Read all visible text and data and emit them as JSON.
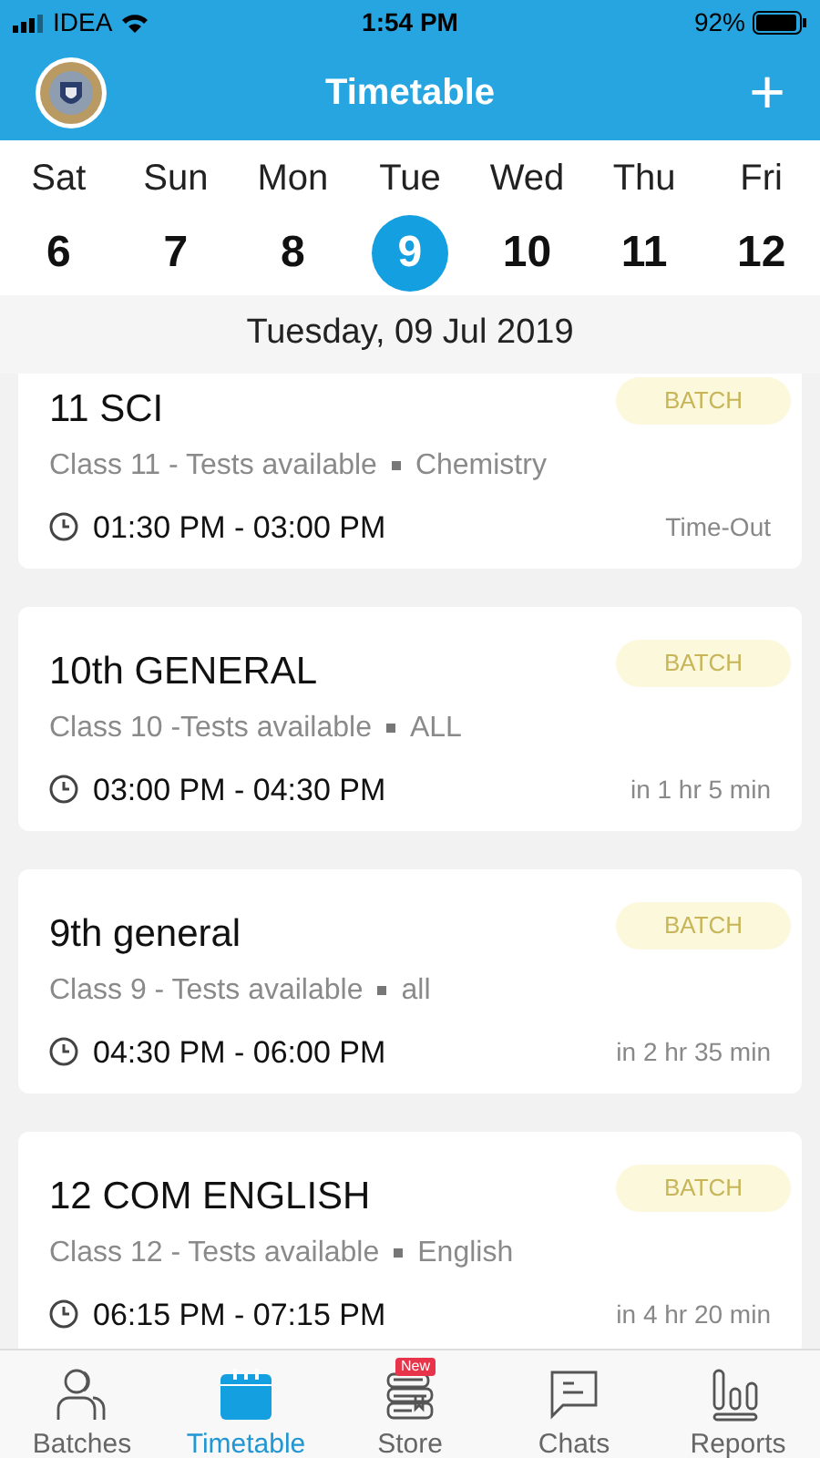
{
  "status_bar": {
    "carrier": "IDEA",
    "time": "1:54 PM",
    "battery": "92%"
  },
  "header": {
    "title": "Timetable",
    "action": "+"
  },
  "days": [
    {
      "weekday": "Sat",
      "date": "6",
      "selected": false
    },
    {
      "weekday": "Sun",
      "date": "7",
      "selected": false
    },
    {
      "weekday": "Mon",
      "date": "8",
      "selected": false
    },
    {
      "weekday": "Tue",
      "date": "9",
      "selected": true
    },
    {
      "weekday": "Wed",
      "date": "10",
      "selected": false
    },
    {
      "weekday": "Thu",
      "date": "11",
      "selected": false
    },
    {
      "weekday": "Fri",
      "date": "12",
      "selected": false
    }
  ],
  "date_heading": "Tuesday, 09 Jul 2019",
  "sessions": [
    {
      "title": "11 SCI",
      "badge": "BATCH",
      "class": "Class 11 - Tests available",
      "subject": "Chemistry",
      "time": "01:30 PM - 03:00 PM",
      "status": "Time-Out"
    },
    {
      "title": "10th GENERAL",
      "badge": "BATCH",
      "class": "Class 10 -Tests available",
      "subject": "ALL",
      "time": "03:00 PM - 04:30 PM",
      "status": "in 1 hr 5 min"
    },
    {
      "title": "9th general",
      "badge": "BATCH",
      "class": "Class 9 - Tests available",
      "subject": "all",
      "time": "04:30 PM - 06:00 PM",
      "status": "in 2 hr 35 min"
    },
    {
      "title": "12 COM ENGLISH",
      "badge": "BATCH",
      "class": "Class 12 - Tests available",
      "subject": "English",
      "time": "06:15 PM - 07:15 PM",
      "status": "in 4 hr 20 min"
    }
  ],
  "tabs": [
    {
      "kind": "batches",
      "label": "Batches",
      "selected": false
    },
    {
      "kind": "timetable",
      "label": "Timetable",
      "selected": true
    },
    {
      "kind": "store",
      "label": "Store",
      "selected": false,
      "badge": "New"
    },
    {
      "kind": "chats",
      "label": "Chats",
      "selected": false
    },
    {
      "kind": "reports",
      "label": "Reports",
      "selected": false
    }
  ]
}
